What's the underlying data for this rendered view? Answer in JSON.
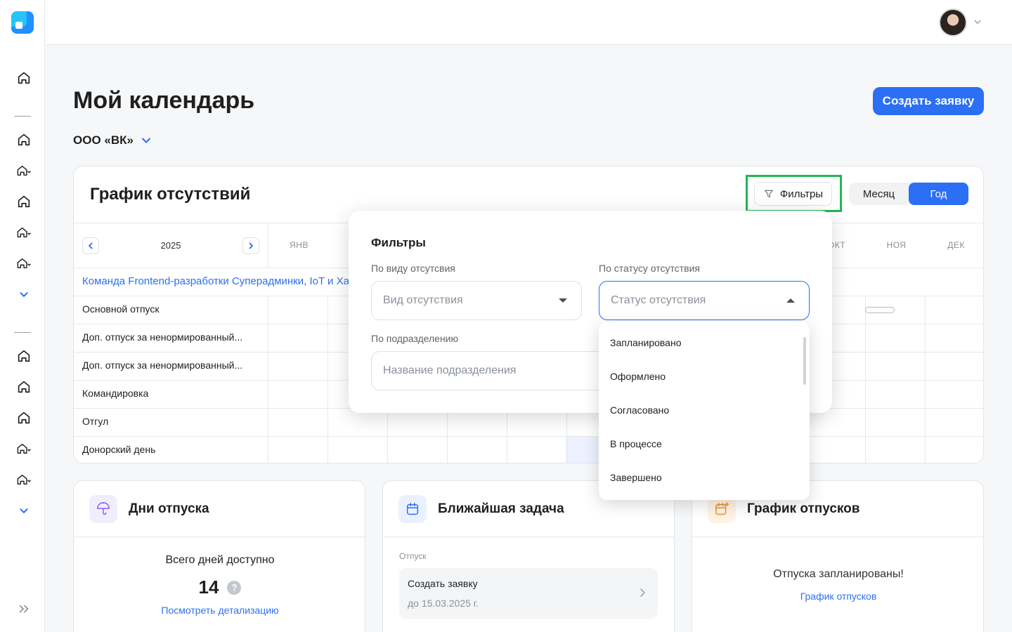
{
  "header": {
    "avatar_alt": "user-avatar"
  },
  "page": {
    "title": "Мой календарь",
    "create_button": "Создать заявку",
    "organization": "ООО «ВК»"
  },
  "schedule": {
    "title": "График отсутствий",
    "filters_button": "Фильтры",
    "view_month": "Месяц",
    "view_year": "Год",
    "year": "2025",
    "months": [
      "ЯНВ",
      "ОКТ",
      "НОЯ",
      "ДЕК"
    ],
    "team": "Команда Frontend-разработки Суперадминки, IoT и Хаа",
    "rows": [
      "Основной отпуск",
      "Доп. отпуск за ненормированный...",
      "Доп. отпуск за ненормированный...",
      "Командировка",
      "Отгул",
      "Донорский день"
    ]
  },
  "filters": {
    "title": "Фильтры",
    "by_type_label": "По виду отсутсвия",
    "type_placeholder": "Вид отсутствия",
    "by_status_label": "По статусу отсутствия",
    "status_placeholder": "Статус отсутствия",
    "by_department_label": "По подразделению",
    "department_placeholder": "Название подразделения",
    "status_options": [
      "Запланировано",
      "Оформлено",
      "Согласовано",
      "В процессе",
      "Завершено"
    ]
  },
  "cards": {
    "vacation_days": {
      "title": "Дни отпуска",
      "total_label": "Всего дней доступно",
      "total": "14",
      "help": "?",
      "link": "Посмотреть детализацию"
    },
    "nearest_task": {
      "title": "Ближайшая задача",
      "category": "Отпуск",
      "task_name": "Создать заявку",
      "task_due": "до 15.03.2025 г."
    },
    "vacation_schedule": {
      "title": "График отпусков",
      "status": "Отпуска запланированы!",
      "link": "График отпусков"
    }
  },
  "colors": {
    "accent": "#2b6ff5",
    "highlight": "#1db954"
  },
  "icons": [
    "home-icon",
    "funnel-icon",
    "umbrella-icon",
    "calendar-icon",
    "calendar-plus-icon"
  ]
}
